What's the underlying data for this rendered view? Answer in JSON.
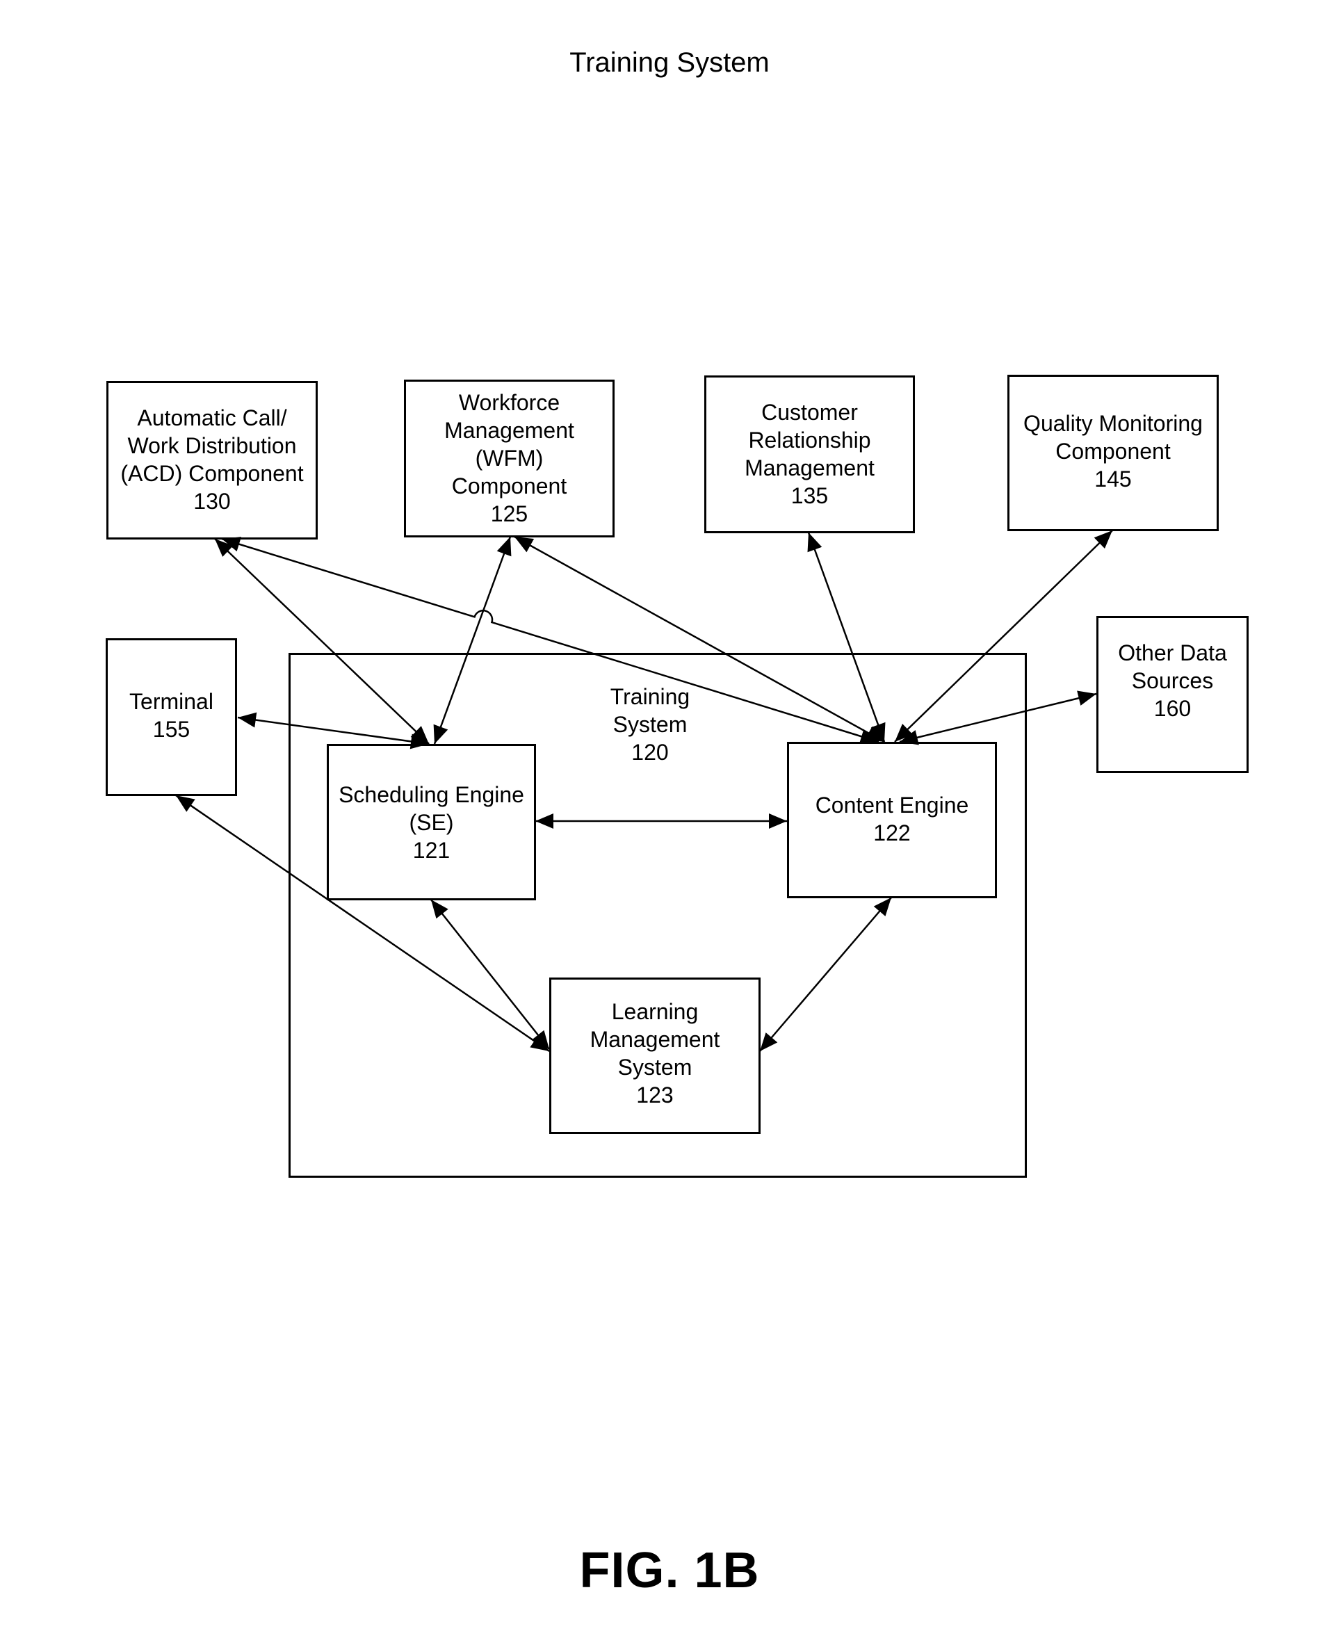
{
  "title": "Training System",
  "figure_label": "FIG. 1B",
  "container": {
    "id": "training-system",
    "lines": [
      "Training",
      "System",
      "120"
    ]
  },
  "nodes": {
    "acd": {
      "lines": [
        "Automatic Call/",
        "Work Distribution",
        "(ACD) Component",
        "130"
      ]
    },
    "wfm": {
      "lines": [
        "Workforce",
        "Management",
        "(WFM)",
        "Component",
        "125"
      ]
    },
    "crm": {
      "lines": [
        "Customer",
        "Relationship",
        "Management",
        "135"
      ]
    },
    "qm": {
      "lines": [
        "Quality Monitoring",
        "Component",
        "145"
      ]
    },
    "terminal": {
      "lines": [
        "Terminal",
        "155"
      ]
    },
    "other": {
      "lines": [
        "Other Data",
        "Sources",
        "160"
      ]
    },
    "se": {
      "lines": [
        "Scheduling Engine",
        "(SE)",
        "121"
      ]
    },
    "ce": {
      "lines": [
        "Content Engine",
        "122"
      ]
    },
    "lms": {
      "lines": [
        "Learning",
        "Management",
        "System",
        "123"
      ]
    }
  },
  "edges": [
    {
      "from": "acd",
      "to": "se",
      "bidirectional": true
    },
    {
      "from": "wfm",
      "to": "se",
      "bidirectional": true
    },
    {
      "from": "terminal",
      "to": "se",
      "bidirectional": true
    },
    {
      "from": "acd",
      "to": "ce",
      "bidirectional": true,
      "line_hop": true
    },
    {
      "from": "wfm",
      "to": "ce",
      "bidirectional": true
    },
    {
      "from": "crm",
      "to": "ce",
      "bidirectional": true
    },
    {
      "from": "qm",
      "to": "ce",
      "bidirectional": true
    },
    {
      "from": "other",
      "to": "ce",
      "bidirectional": true
    },
    {
      "from": "se",
      "to": "ce",
      "bidirectional": true
    },
    {
      "from": "terminal",
      "to": "lms",
      "bidirectional": true
    },
    {
      "from": "se",
      "to": "lms",
      "bidirectional": true
    },
    {
      "from": "ce",
      "to": "lms",
      "bidirectional": true
    }
  ]
}
